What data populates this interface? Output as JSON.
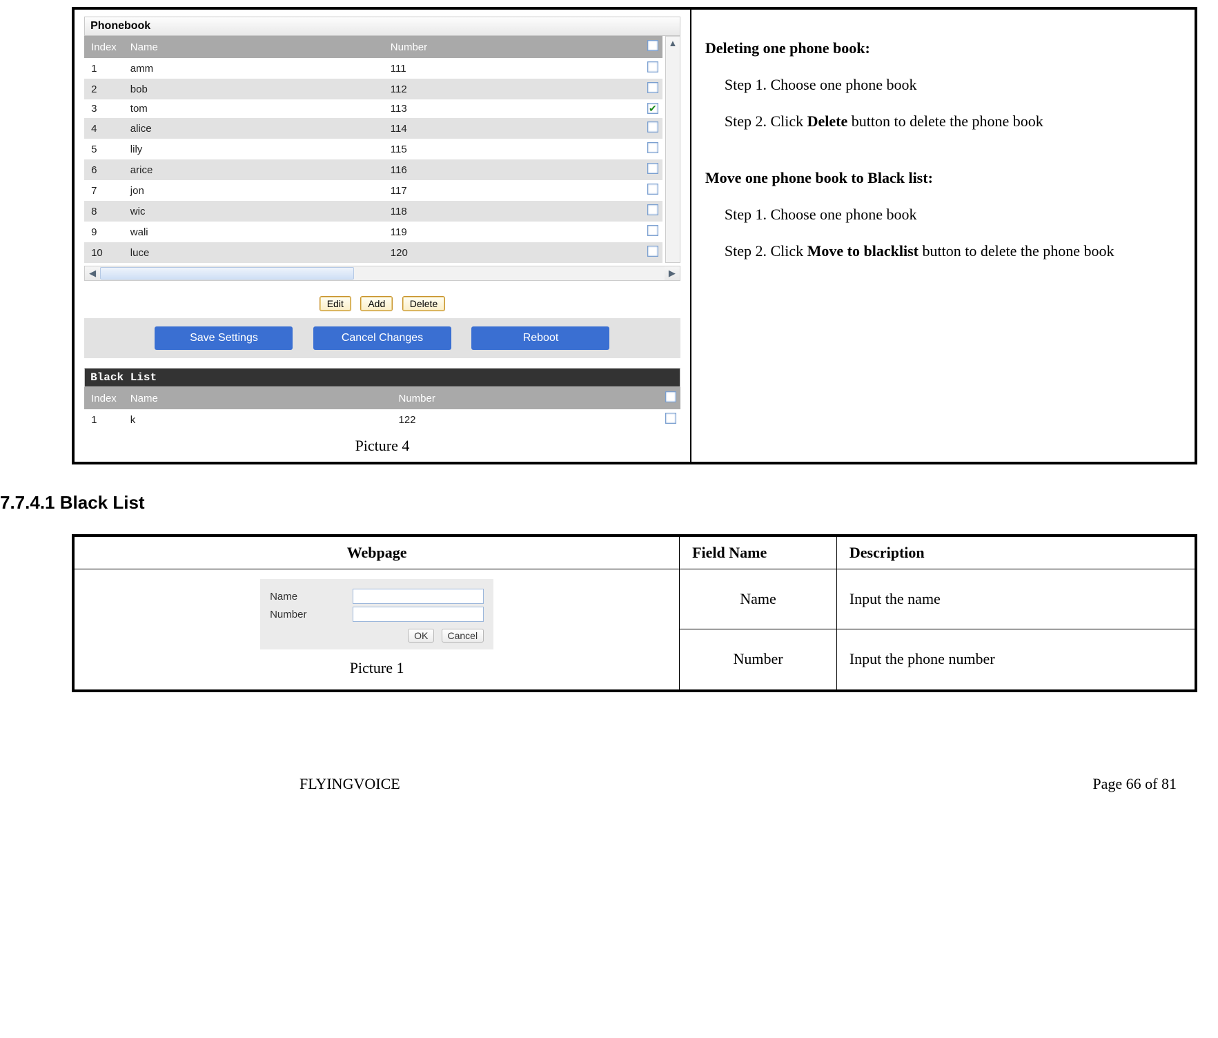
{
  "phonebook": {
    "panel_title": "Phonebook",
    "headers": {
      "index": "Index",
      "name": "Name",
      "number": "Number"
    },
    "rows": [
      {
        "index": "1",
        "name": "amm",
        "number": "111",
        "checked": false
      },
      {
        "index": "2",
        "name": "bob",
        "number": "112",
        "checked": false
      },
      {
        "index": "3",
        "name": "tom",
        "number": "113",
        "checked": true
      },
      {
        "index": "4",
        "name": "alice",
        "number": "114",
        "checked": false
      },
      {
        "index": "5",
        "name": "lily",
        "number": "115",
        "checked": false
      },
      {
        "index": "6",
        "name": "arice",
        "number": "116",
        "checked": false
      },
      {
        "index": "7",
        "name": "jon",
        "number": "117",
        "checked": false
      },
      {
        "index": "8",
        "name": "wic",
        "number": "118",
        "checked": false
      },
      {
        "index": "9",
        "name": "wali",
        "number": "119",
        "checked": false
      },
      {
        "index": "10",
        "name": "luce",
        "number": "120",
        "checked": false
      }
    ],
    "buttons": {
      "edit": "Edit",
      "add": "Add",
      "delete": "Delete"
    },
    "actions": {
      "save": "Save Settings",
      "cancel": "Cancel Changes",
      "reboot": "Reboot"
    }
  },
  "blacklist": {
    "panel_title": "Black List",
    "headers": {
      "index": "Index",
      "name": "Name",
      "number": "Number"
    },
    "rows": [
      {
        "index": "1",
        "name": "k",
        "number": "122",
        "checked": false
      }
    ]
  },
  "captions": {
    "picture4": "Picture 4",
    "picture1": "Picture 1"
  },
  "instructions": {
    "delete_heading": "Deleting one phone book:",
    "delete_step1": "Step 1. Choose one phone book",
    "delete_step2_prefix": "Step 2. Click ",
    "delete_step2_bold": "Delete",
    "delete_step2_suffix": " button to delete the phone book",
    "move_heading": "Move one phone book to Black list:",
    "move_step1": "Step 1. Choose one phone book",
    "move_step2_prefix": "Step 2. Click ",
    "move_step2_bold": "Move to blacklist",
    "move_step2_suffix": " button to delete the phone book"
  },
  "section": {
    "heading": "7.7.4.1  Black List"
  },
  "def_table": {
    "headers": {
      "webpage": "Webpage",
      "field_name": "Field Name",
      "description": "Description"
    },
    "rows": [
      {
        "field": "Name",
        "description": "Input the name"
      },
      {
        "field": "Number",
        "description": "Input the phone number"
      }
    ]
  },
  "form": {
    "labels": {
      "name": "Name",
      "number": "Number"
    },
    "buttons": {
      "ok": "OK",
      "cancel": "Cancel"
    }
  },
  "footer": {
    "brand": "FLYINGVOICE",
    "page": "Page  66  of  81"
  }
}
